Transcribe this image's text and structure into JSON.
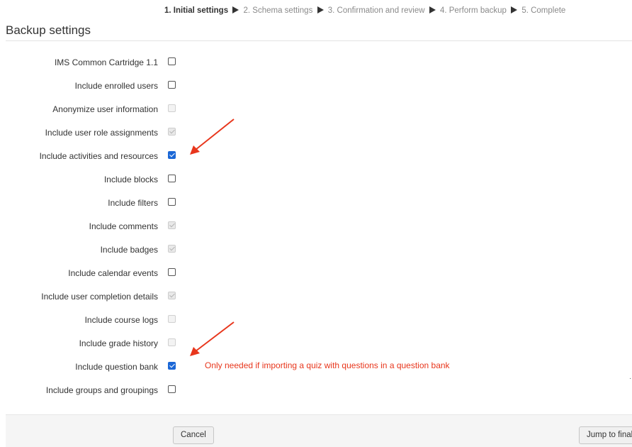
{
  "progress": {
    "steps": [
      {
        "label": "1. Initial settings",
        "current": true
      },
      {
        "label": "2. Schema settings",
        "current": false
      },
      {
        "label": "3. Confirmation and review",
        "current": false
      },
      {
        "label": "4. Perform backup",
        "current": false
      },
      {
        "label": "5. Complete",
        "current": false
      }
    ],
    "separator_icon": "triangle-right-icon"
  },
  "title": "Backup settings",
  "settings": [
    {
      "label": "IMS Common Cartridge 1.1",
      "checked": false,
      "disabled": false
    },
    {
      "label": "Include enrolled users",
      "checked": false,
      "disabled": false
    },
    {
      "label": "Anonymize user information",
      "checked": false,
      "disabled": true
    },
    {
      "label": "Include user role assignments",
      "checked": true,
      "disabled": true
    },
    {
      "label": "Include activities and resources",
      "checked": true,
      "disabled": false
    },
    {
      "label": "Include blocks",
      "checked": false,
      "disabled": false
    },
    {
      "label": "Include filters",
      "checked": false,
      "disabled": false
    },
    {
      "label": "Include comments",
      "checked": true,
      "disabled": true
    },
    {
      "label": "Include badges",
      "checked": true,
      "disabled": true
    },
    {
      "label": "Include calendar events",
      "checked": false,
      "disabled": false
    },
    {
      "label": "Include user completion details",
      "checked": true,
      "disabled": true
    },
    {
      "label": "Include course logs",
      "checked": false,
      "disabled": true
    },
    {
      "label": "Include grade history",
      "checked": false,
      "disabled": true
    },
    {
      "label": "Include question bank",
      "checked": true,
      "disabled": false
    },
    {
      "label": "Include groups and groupings",
      "checked": false,
      "disabled": false
    }
  ],
  "annotation": {
    "note": "Only needed if importing a quiz with questions in a question bank",
    "color": "#e8361c"
  },
  "buttons": {
    "cancel": "Cancel",
    "jump": "Jump to final step"
  },
  "colors": {
    "checkbox_checked": "#1b67d6",
    "footer_bg": "#f5f5f5"
  }
}
